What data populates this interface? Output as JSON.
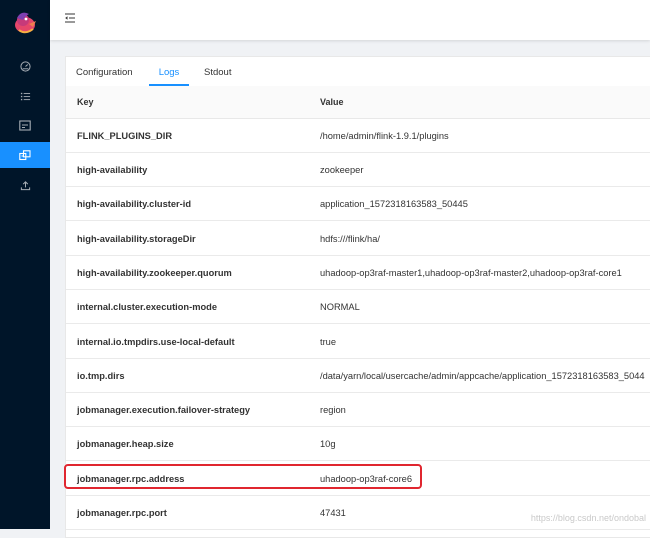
{
  "tabs": [
    {
      "label": "Configuration",
      "active": false
    },
    {
      "label": "Logs",
      "active": true
    },
    {
      "label": "Stdout",
      "active": false
    }
  ],
  "table": {
    "headers": {
      "key": "Key",
      "value": "Value"
    },
    "rows": [
      {
        "key": "FLINK_PLUGINS_DIR",
        "value": "/home/admin/flink-1.9.1/plugins"
      },
      {
        "key": "high-availability",
        "value": "zookeeper"
      },
      {
        "key": "high-availability.cluster-id",
        "value": "application_1572318163583_50445"
      },
      {
        "key": "high-availability.storageDir",
        "value": "hdfs:///flink/ha/"
      },
      {
        "key": "high-availability.zookeeper.quorum",
        "value": "uhadoop-op3raf-master1,uhadoop-op3raf-master2,uhadoop-op3raf-core1"
      },
      {
        "key": "internal.cluster.execution-mode",
        "value": "NORMAL"
      },
      {
        "key": "internal.io.tmpdirs.use-local-default",
        "value": "true"
      },
      {
        "key": "io.tmp.dirs",
        "value": "/data/yarn/local/usercache/admin/appcache/application_1572318163583_5044"
      },
      {
        "key": "jobmanager.execution.failover-strategy",
        "value": "region"
      },
      {
        "key": "jobmanager.heap.size",
        "value": "10g"
      },
      {
        "key": "jobmanager.rpc.address",
        "value": "uhadoop-op3raf-core6",
        "highlighted": true
      },
      {
        "key": "jobmanager.rpc.port",
        "value": "47431"
      }
    ]
  },
  "sidebar": {
    "icons": [
      "dashboard-icon",
      "list-icon",
      "window-icon",
      "cluster-icon",
      "upload-icon"
    ],
    "active_index": 3
  },
  "watermark": "https://blog.csdn.net/ondobal",
  "colors": {
    "sidebar": "#001529",
    "accent": "#1890ff",
    "highlight": "#e0262f"
  }
}
